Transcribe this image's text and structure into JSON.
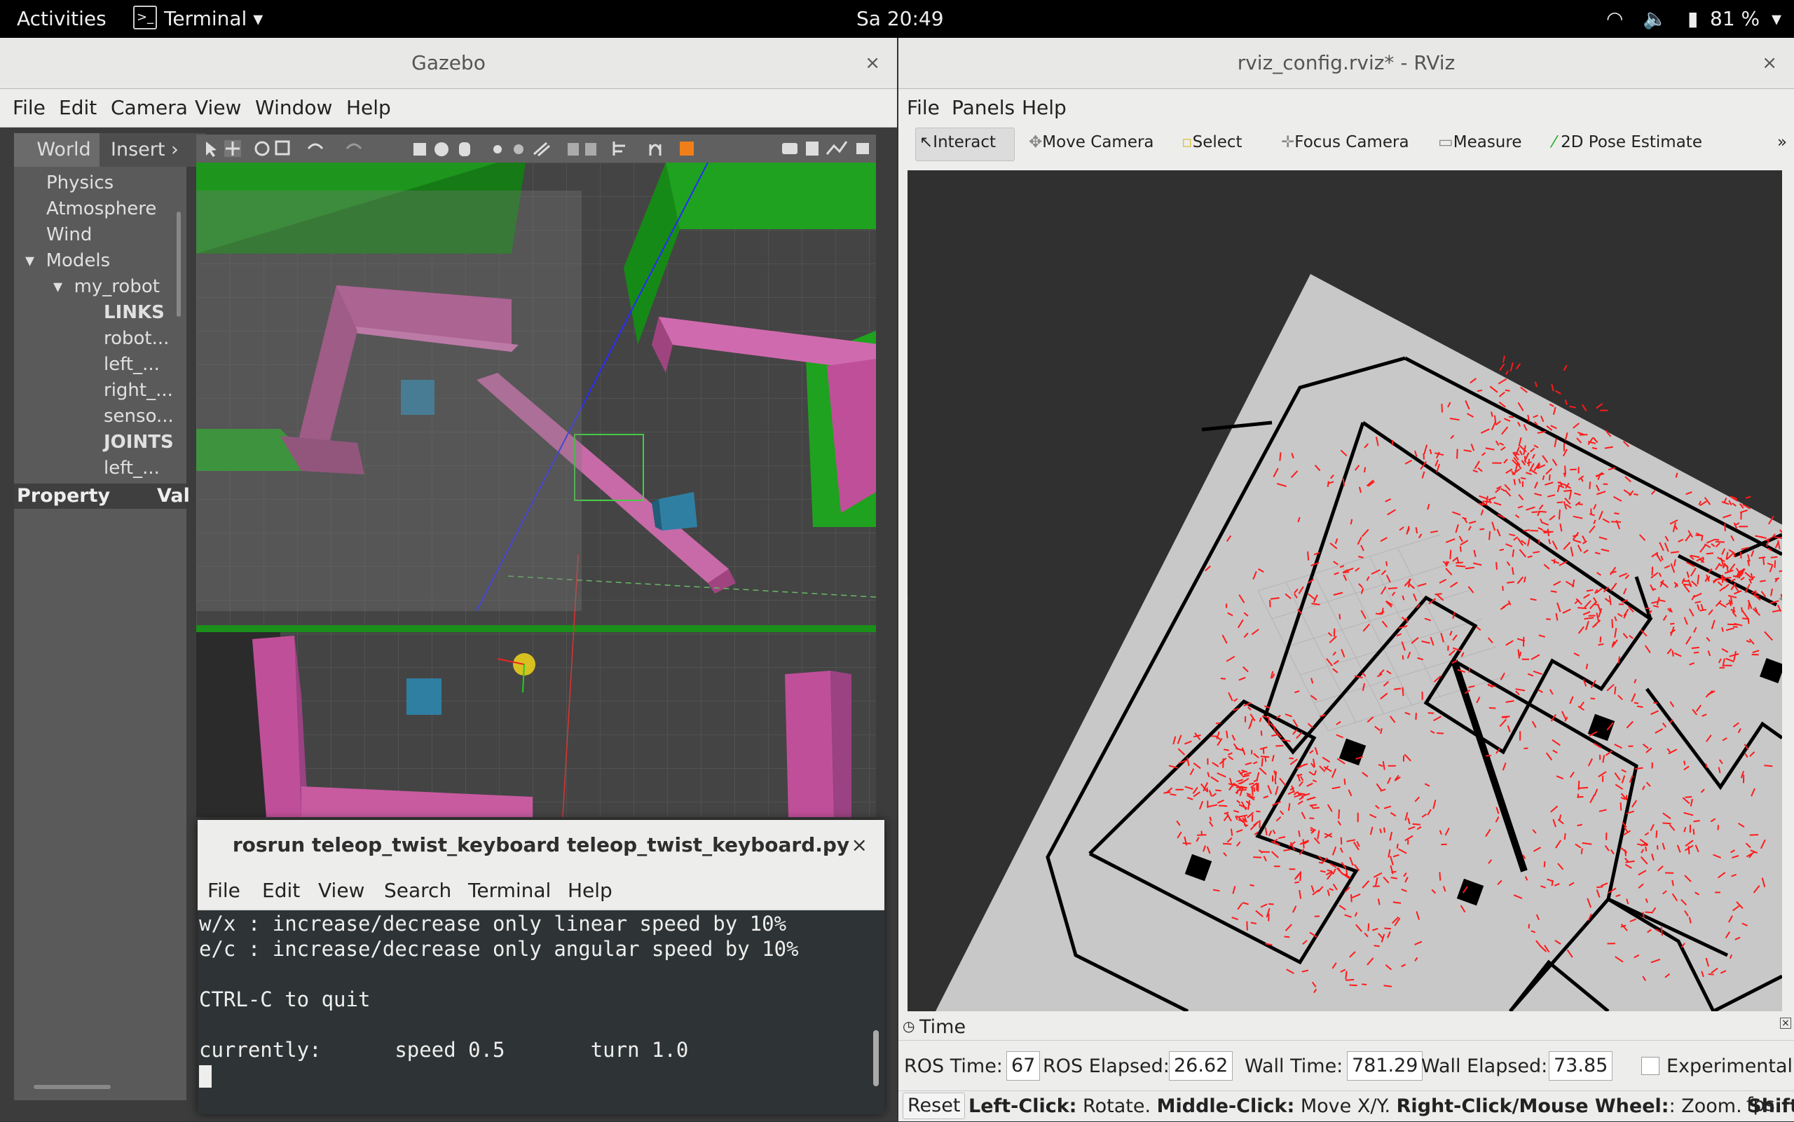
{
  "topbar": {
    "activities": "Activities",
    "app_menu": "Terminal",
    "clock": "Sa 20:49",
    "battery": "81 %"
  },
  "gazebo": {
    "title": "Gazebo",
    "close": "×",
    "menu": [
      "File",
      "Edit",
      "Camera",
      "View",
      "Window",
      "Help"
    ],
    "tabs": [
      "World",
      "Insert"
    ],
    "tree": {
      "physics": "Physics",
      "atmosphere": "Atmosphere",
      "wind": "Wind",
      "models": "Models",
      "my_robot": "my_robot",
      "links": "LINKS",
      "link1": "robot...",
      "link2": "left_...",
      "link3": "right_...",
      "link4": "senso...",
      "joints": "JOINTS",
      "joint1": "left_..."
    },
    "property_header": "Property",
    "value_header": "Val"
  },
  "terminal": {
    "title": "rosrun teleop_twist_keyboard teleop_twist_keyboard.py",
    "close": "×",
    "menu": [
      "File",
      "Edit",
      "View",
      "Search",
      "Terminal",
      "Help"
    ],
    "lines": [
      "w/x : increase/decrease only linear speed by 10%",
      "e/c : increase/decrease only angular speed by 10%",
      "",
      "CTRL-C to quit",
      "",
      "currently:      speed 0.5       turn 1.0"
    ]
  },
  "rviz": {
    "title": "rviz_config.rviz* - RViz",
    "close": "×",
    "menu": [
      "File",
      "Panels",
      "Help"
    ],
    "tools": [
      "Interact",
      "Move Camera",
      "Select",
      "Focus Camera",
      "Measure",
      "2D Pose Estimate"
    ],
    "more": "»",
    "time_panel": {
      "title": "Time",
      "ros_time_label": "ROS Time:",
      "ros_time": "67",
      "ros_elapsed_label": "ROS Elapsed:",
      "ros_elapsed": "26.62",
      "wall_time_label": "Wall Time:",
      "wall_time": "781.29",
      "wall_elapsed_label": "Wall Elapsed:",
      "wall_elapsed": "73.85",
      "experimental": "Experimental"
    },
    "status": {
      "reset": "Reset",
      "left_click_k": "Left-Click:",
      "left_click_v": " Rotate. ",
      "middle_click_k": "Middle-Click:",
      "middle_click_v": " Move X/Y. ",
      "right_click_k": "Right-Click/Mouse Wheel:",
      "right_click_v": ": Zoom. ",
      "shift_k": "Shift:",
      "fps": "fps"
    }
  },
  "colors": {
    "wall_green": "#1fa21f",
    "wall_pink": "#c25a9a",
    "box_blue": "#2f7fa3",
    "scan_red": "#ff1a1a"
  }
}
